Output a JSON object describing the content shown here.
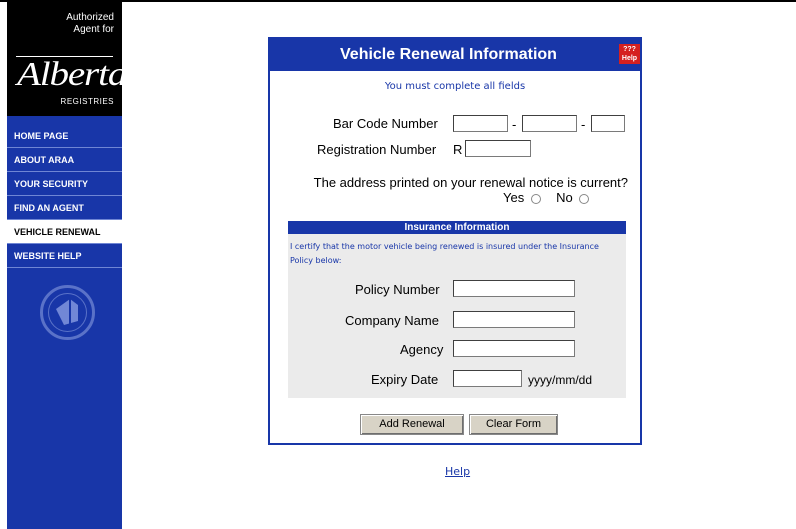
{
  "sidebar": {
    "authorized_line1": "Authorized",
    "authorized_line2": "Agent for",
    "logo_word": "Alberta",
    "logo_sub": "REGISTRIES",
    "items": [
      {
        "label": "HOME PAGE"
      },
      {
        "label": "ABOUT ARAA"
      },
      {
        "label": "YOUR SECURITY"
      },
      {
        "label": "FIND AN AGENT"
      },
      {
        "label": "VEHICLE RENEWAL",
        "active": true
      },
      {
        "label": "WEBSITE HELP"
      }
    ]
  },
  "form": {
    "title": "Vehicle Renewal Information",
    "help_icon_top": "???",
    "help_icon_bottom": "Help",
    "instruction": "You must complete all fields",
    "barcode_label": "Bar Code Number",
    "barcode_sep": "-",
    "registration_label": "Registration Number",
    "registration_prefix": "R",
    "address_question": "The address printed on your renewal notice is current?",
    "yes_label": "Yes",
    "no_label": "No",
    "insurance_heading": "Insurance Information",
    "certify_text": "I certify that the motor vehicle being renewed is insured under the Insurance Policy below:",
    "policy_label": "Policy Number",
    "company_label": "Company Name",
    "agency_label": "Agency",
    "expiry_label": "Expiry Date",
    "expiry_format": "yyyy/mm/dd",
    "add_button": "Add Renewal",
    "clear_button": "Clear Form"
  },
  "footer": {
    "help_link": "Help"
  }
}
